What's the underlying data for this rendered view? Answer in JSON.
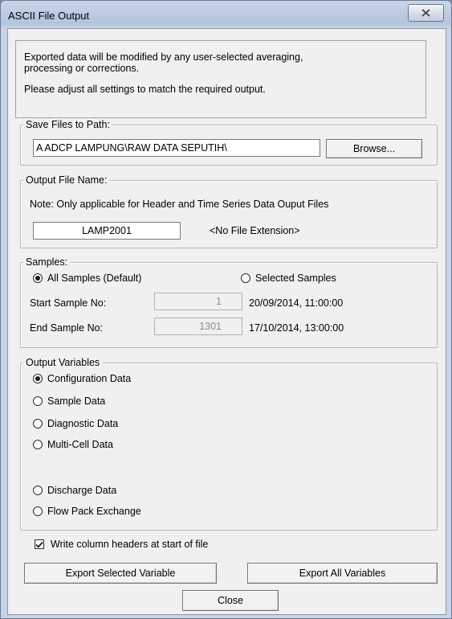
{
  "window": {
    "title": "ASCII File Output",
    "close_icon": "close-icon"
  },
  "info": {
    "line1": "Exported data will be modified by any user-selected averaging,",
    "line2": "processing or corrections.",
    "line3": "Please adjust all settings to match the required output."
  },
  "save_path": {
    "legend": "Save Files to Path:",
    "value": "A ADCP LAMPUNG\\RAW DATA SEPUTIH\\",
    "browse_label": "Browse..."
  },
  "output_name": {
    "legend": "Output File Name:",
    "note": "Note: Only applicable for Header and Time Series Data Ouput Files",
    "value": "LAMP2001",
    "extension_note": "<No File Extension>"
  },
  "samples": {
    "legend": "Samples:",
    "all_label": "All Samples (Default)",
    "selected_label": "Selected Samples",
    "mode": "all",
    "start_label": "Start Sample No:",
    "start_value": "1",
    "start_time": "20/09/2014,  11:00:00",
    "end_label": "End Sample No:",
    "end_value": "1301",
    "end_time": "17/10/2014,  13:00:00"
  },
  "output_variables": {
    "legend": "Output Variables",
    "options": [
      "Configuration Data",
      "Sample Data",
      "Diagnostic Data",
      "Multi-Cell Data",
      "Discharge Data",
      "Flow Pack Exchange"
    ],
    "selected": "Configuration Data"
  },
  "write_headers": {
    "label": "Write column headers at start of file",
    "checked": true
  },
  "buttons": {
    "export_selected": "Export Selected Variable",
    "export_all": "Export All Variables",
    "close": "Close"
  }
}
